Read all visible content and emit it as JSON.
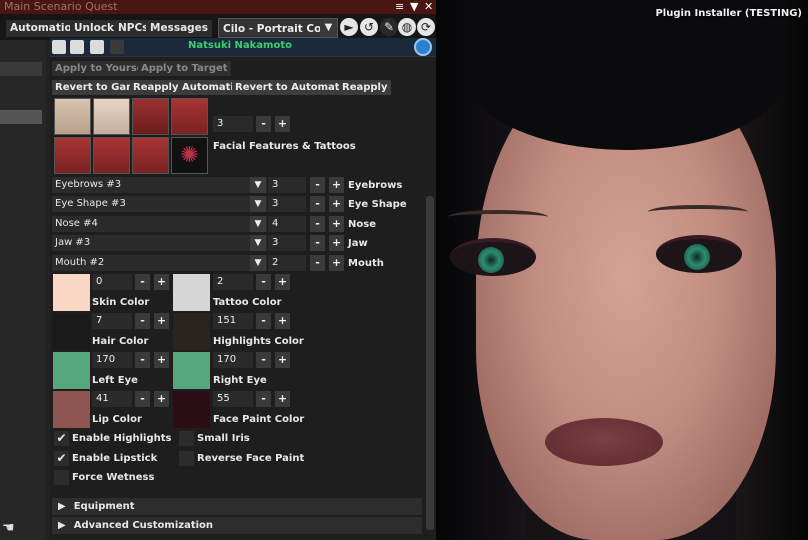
{
  "window": {
    "title": "Main Scenario Quest",
    "top_icons": [
      "≡",
      "▼",
      "✕"
    ]
  },
  "menu": [
    "Automation",
    "Unlocks",
    "NPCs",
    "Messages"
  ],
  "design_select": {
    "value": "Cilo - Portrait Commis",
    "arrow": "▼"
  },
  "plugin_info": {
    "line1": "Plugin Installer (TESTING)"
  },
  "panel": {
    "character_name": "Natsuki Nakamoto",
    "apply_yourself": "Apply to Yourself",
    "apply_target": "Apply to Target",
    "revert_game": "Revert to Game",
    "reapply_automation": "Reapply Automation",
    "revert_automation": "Revert to Automation",
    "reapply": "Reapply",
    "features_value": "3",
    "facial_features_label": "Facial Features & Tattoos",
    "combos": [
      {
        "value": "Eyebrows #3",
        "num": "3",
        "label": "Eyebrows"
      },
      {
        "value": "Eye Shape #3",
        "num": "3",
        "label": "Eye Shape"
      },
      {
        "value": "Nose #4",
        "num": "4",
        "label": "Nose"
      },
      {
        "value": "Jaw #3",
        "num": "3",
        "label": "Jaw"
      },
      {
        "value": "Mouth #2",
        "num": "2",
        "label": "Mouth"
      }
    ],
    "colors": [
      {
        "value": "0",
        "label": "Skin Color",
        "hex": "#f8d8c4"
      },
      {
        "value": "2",
        "label": "Tattoo Color",
        "hex": "#d6d6d6"
      },
      {
        "value": "7",
        "label": "Hair Color",
        "hex": "#1a1a1a"
      },
      {
        "value": "151",
        "label": "Highlights Color",
        "hex": "#29241f"
      },
      {
        "value": "170",
        "label": "Left Eye",
        "hex": "#56a67e"
      },
      {
        "value": "170",
        "label": "Right Eye",
        "hex": "#56a67e"
      },
      {
        "value": "41",
        "label": "Lip Color",
        "hex": "#8e5551"
      },
      {
        "value": "55",
        "label": "Face Paint Color",
        "hex": "#2a0e14"
      }
    ],
    "checks": [
      {
        "label": "Enable Highlights",
        "checked": true
      },
      {
        "label": "Small Iris",
        "checked": false
      },
      {
        "label": "Enable Lipstick",
        "checked": true
      },
      {
        "label": "Reverse Face Paint",
        "checked": false
      },
      {
        "label": "Force Wetness",
        "checked": false
      }
    ],
    "sections": [
      "Equipment",
      "Advanced Customization"
    ],
    "minus": "-",
    "plus": "+",
    "checkmark": "✔",
    "expand_arrow": "▶"
  }
}
